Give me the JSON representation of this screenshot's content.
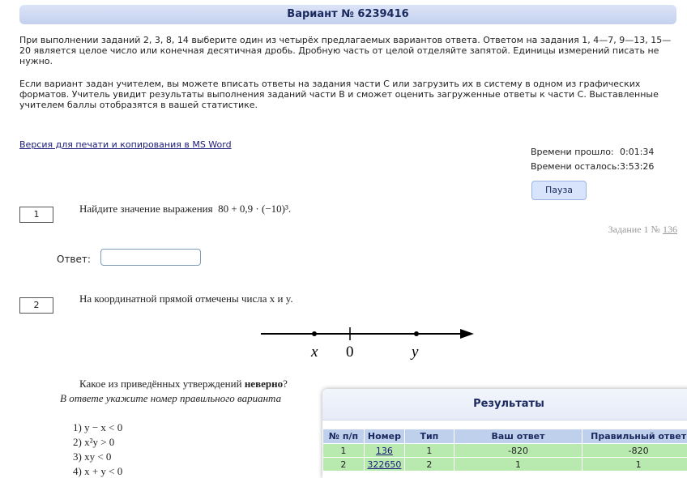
{
  "header": {
    "title": "Вариант № 6239416"
  },
  "intro": {
    "p1": "При выполнении заданий 2, 3, 8, 14 выберите один из четырёх предлагаемых вариантов ответа. Ответом на задания 1, 4—7, 9—13, 15—20 является целое число или конечная десятичная дробь. Дробную часть от целой отделяйте запятой. Единицы измерений писать не нужно.",
    "p2": "Если вариант задан учителем, вы можете вписать ответы на задания части С или загрузить их в систему в одном из графических форматов. Учитель увидит результаты выполнения заданий части В и сможет оценить загруженные ответы к части С. Выставленные учителем баллы отобразятся в вашей статистике."
  },
  "print_link": "Версия для печати и копирования в MS Word",
  "timer": {
    "elapsed_label": "Времени прошло:",
    "elapsed_value": "0:01:34",
    "left_label": "Времени осталось:",
    "left_value": "3:53:26",
    "pause_label": "Пауза"
  },
  "q1": {
    "num": "1",
    "text": "Найдите значение выражения",
    "formula": "80 + 0,9 · (−10)³.",
    "ref_label": "Задание 1 №",
    "ref_link": "136",
    "answer_label": "Ответ:"
  },
  "q2": {
    "num": "2",
    "text": "На координатной прямой отмечены числа x и y.",
    "axis_labels": [
      "x",
      "0",
      "y"
    ],
    "question_pre": "Какое из приведённых утверждений ",
    "question_bold": "неверно",
    "question_post": "?",
    "hint": "В ответе укажите номер правильного варианта",
    "options": [
      "1) y − x < 0",
      "2) x²y > 0",
      "3) xy < 0",
      "4) x + y < 0"
    ]
  },
  "results": {
    "title": "Результаты",
    "columns": [
      "№ п/п",
      "Номер",
      "Тип",
      "Ваш ответ",
      "Правильный ответ"
    ],
    "rows": [
      [
        "1",
        "136",
        "1",
        "-820",
        "-820"
      ],
      [
        "2",
        "322650",
        "2",
        "1",
        "1"
      ]
    ],
    "row_color": "#b8eab0",
    "header_color": "#bfd0ec"
  }
}
